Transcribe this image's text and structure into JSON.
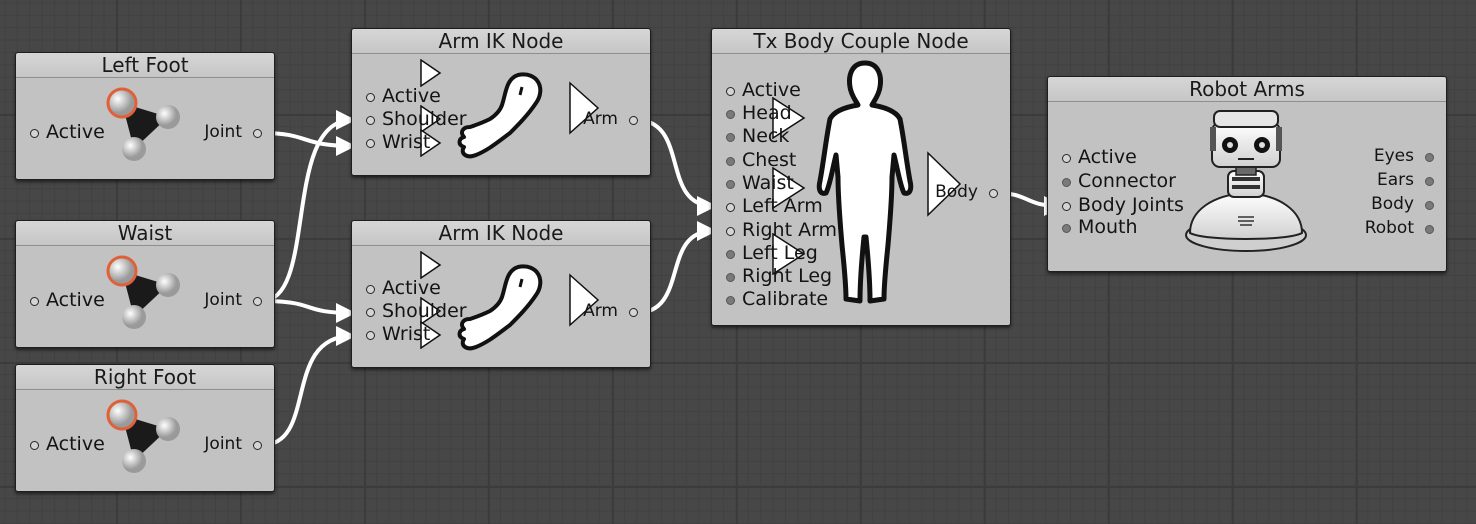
{
  "nodes": {
    "left_foot": {
      "title": "Left Foot",
      "inputs": [
        "Active"
      ],
      "outputs": [
        "Joint"
      ]
    },
    "waist": {
      "title": "Waist",
      "inputs": [
        "Active"
      ],
      "outputs": [
        "Joint"
      ]
    },
    "right_foot": {
      "title": "Right Foot",
      "inputs": [
        "Active"
      ],
      "outputs": [
        "Joint"
      ]
    },
    "arm_ik_1": {
      "title": "Arm IK Node",
      "inputs": [
        "Active",
        "Shoulder",
        "Wrist"
      ],
      "outputs": [
        "Arm"
      ]
    },
    "arm_ik_2": {
      "title": "Arm IK Node",
      "inputs": [
        "Active",
        "Shoulder",
        "Wrist"
      ],
      "outputs": [
        "Arm"
      ]
    },
    "tx_body": {
      "title": "Tx Body Couple Node",
      "inputs": [
        "Active",
        "Head",
        "Neck",
        "Chest",
        "Waist",
        "Left Arm",
        "Right Arm",
        "Left Leg",
        "Right Leg",
        "Calibrate"
      ],
      "outputs": [
        "Body"
      ]
    },
    "robot_arms": {
      "title": "Robot Arms",
      "inputs": [
        "Active",
        "Connector",
        "Body Joints",
        "Mouth"
      ],
      "outputs": [
        "Eyes",
        "Ears",
        "Body",
        "Robot"
      ]
    }
  },
  "icons": {
    "joint": "joint-molecule-icon",
    "arm": "arm-icon",
    "body": "human-body-icon",
    "robot": "robot-icon",
    "play": "play-triangle-icon"
  },
  "colors": {
    "wire": "#ffffff",
    "joint_highlight": "#e0603a",
    "canvas": "#474747",
    "node_bg": "#c2c2c2"
  }
}
